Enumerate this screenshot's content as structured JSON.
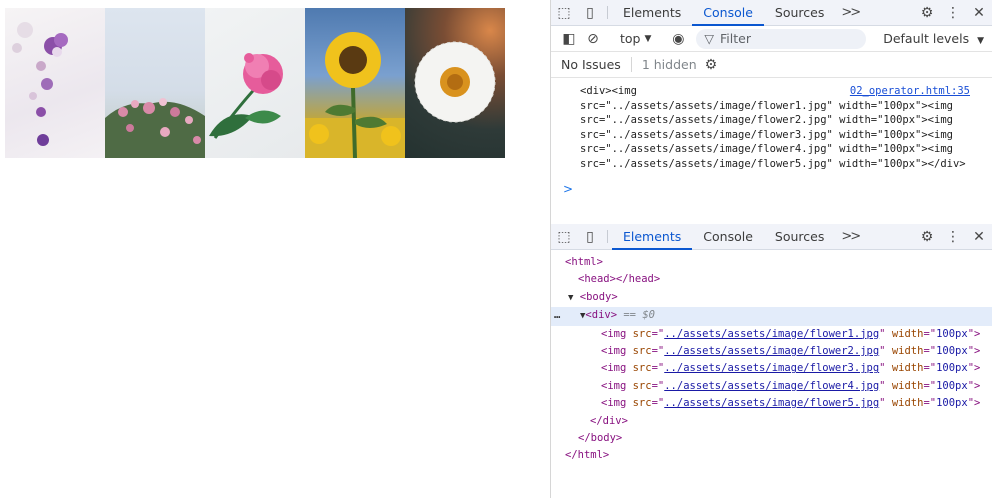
{
  "images": [
    {
      "name": "flower1",
      "colors": {
        "bg": "#f3f0f3",
        "petal": "#8b4fa8",
        "accent": "#c9a8c9"
      }
    },
    {
      "name": "flower2",
      "colors": {
        "bg": "#d9e1ec",
        "petal": "#d98aa8",
        "leaf": "#4f6b45"
      }
    },
    {
      "name": "flower3",
      "colors": {
        "bg": "#eef0f2",
        "petal": "#e65c9b",
        "leaf": "#2f6f3c"
      }
    },
    {
      "name": "flower4",
      "colors": {
        "sky": "#5d86bd",
        "petal": "#f0c21c",
        "center": "#5a3a12"
      }
    },
    {
      "name": "flower5",
      "colors": {
        "bg": "#2a3836",
        "petal": "#f4f4f2",
        "center": "#d9921e"
      }
    }
  ],
  "devtools_top": {
    "tabs": [
      "Elements",
      "Console",
      "Sources"
    ],
    "active_tab": "Console",
    "icons": [
      "inspect-icon",
      "device-toggle-icon",
      "more-tabs-icon",
      "settings-icon",
      "kebab-menu-icon",
      "close-icon"
    ],
    "context": "top",
    "filter_placeholder": "Filter",
    "levels": "Default levels",
    "no_issues": "No Issues",
    "hidden": "1 hidden",
    "log_source": "02_operator.html:35",
    "log_lines": [
      "<div><img",
      "src=\"../assets/assets/image/flower1.jpg\" width=\"100px\"><img",
      "src=\"../assets/assets/image/flower2.jpg\" width=\"100px\"><img",
      "src=\"../assets/assets/image/flower3.jpg\" width=\"100px\"><img",
      "src=\"../assets/assets/image/flower4.jpg\" width=\"100px\"><img",
      "src=\"../assets/assets/image/flower5.jpg\" width=\"100px\"></div>"
    ],
    "prompt": ">"
  },
  "devtools_bottom": {
    "tabs": [
      "Elements",
      "Console",
      "Sources"
    ],
    "active_tab": "Elements",
    "html_open": "<html>",
    "head": "<head></head>",
    "body_open": "<body>",
    "div_open": "<div>",
    "div_var": "== $0",
    "img_src_attr": "src",
    "img_width_attr": "width",
    "img_width_val": "100px",
    "img_srcs": [
      "../assets/assets/image/flower1.jpg",
      "../assets/assets/image/flower2.jpg",
      "../assets/assets/image/flower3.jpg",
      "../assets/assets/image/flower4.jpg",
      "../assets/assets/image/flower5.jpg"
    ],
    "div_close": "</div>",
    "body_close": "</body>",
    "html_close": "</html>"
  }
}
